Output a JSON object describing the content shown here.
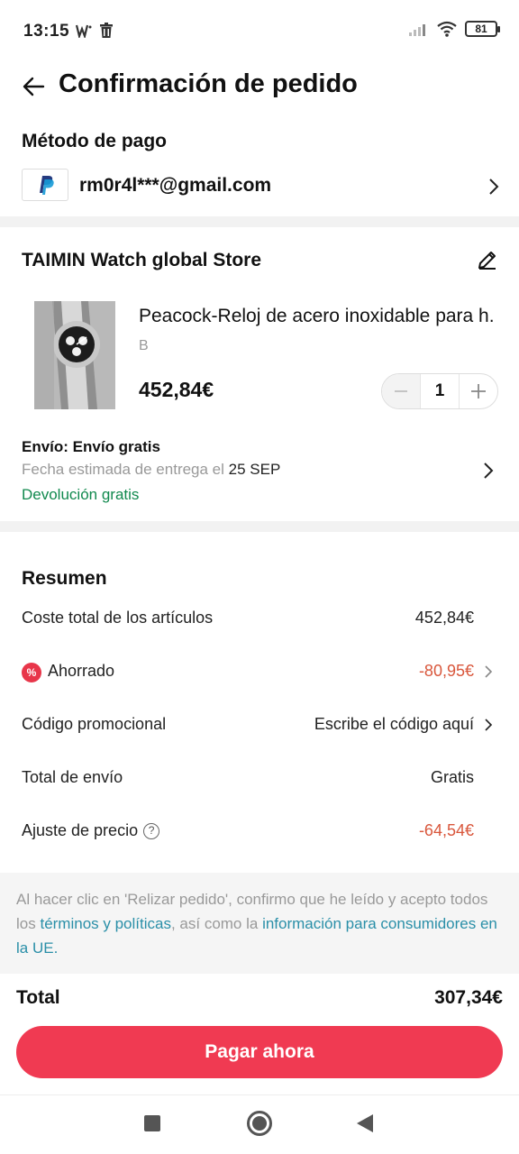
{
  "status_bar": {
    "time": "13:15",
    "battery": "81"
  },
  "header": {
    "title": "Confirmación de pedido"
  },
  "payment": {
    "section_title": "Método de pago",
    "email": "rm0r4l***@gmail.com",
    "method_icon": "paypal-icon"
  },
  "store": {
    "name": "TAIMIN Watch global Store",
    "product": {
      "name": "Peacock-Reloj de acero inoxidable para h...",
      "variant": "B",
      "price": "452,84€",
      "quantity": "1"
    },
    "shipping": {
      "title": "Envío: Envío gratis",
      "date_label": "Fecha estimada de entrega el",
      "date_value": "25 SEP",
      "free_return": "Devolución gratis"
    }
  },
  "summary": {
    "title": "Resumen",
    "rows": [
      {
        "label": "Coste total de los artículos",
        "value": "452,84€"
      },
      {
        "label": "Ahorrado",
        "value": "-80,95€"
      },
      {
        "label": "Código promocional",
        "value": "Escribe el código aquí"
      },
      {
        "label": "Total de envío",
        "value": "Gratis"
      },
      {
        "label": "Ajuste de precio",
        "value": "-64,54€"
      }
    ]
  },
  "legal": {
    "text_1": "Al hacer clic en 'Relizar pedido', confirmo que he leído y acepto todos los",
    "link_1": "términos y políticas",
    "text_2": ", así como la",
    "link_2": "información para consumidores en la UE."
  },
  "total": {
    "label": "Total",
    "value": "307,34€"
  },
  "pay_button": {
    "label": "Pagar ahora"
  },
  "colors": {
    "accent": "#f03a52",
    "discount": "#d9573c",
    "green": "#11894e",
    "link": "#2a8fa8"
  }
}
